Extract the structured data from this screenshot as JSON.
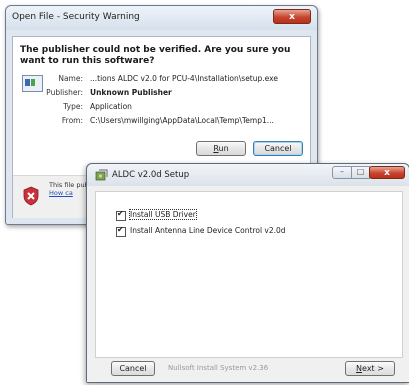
{
  "security_dialog": {
    "title": "Open File - Security Warning",
    "close_label": "x",
    "question": "The publisher could not be verified.  Are you sure you want to run this software?",
    "fields": [
      {
        "label": "Name:",
        "value": "...tions ALDC v2.0 for PCU-4\\Installation\\setup.exe",
        "bold": false
      },
      {
        "label": "Publisher:",
        "value": "Unknown Publisher",
        "bold": true
      },
      {
        "label": "Type:",
        "value": "Application",
        "bold": false
      },
      {
        "label": "From:",
        "value": "C:\\Users\\mwillging\\AppData\\Local\\Temp\\Temp1...",
        "bold": false
      }
    ],
    "run_button": {
      "accel": "R",
      "rest": "un"
    },
    "cancel_button": "Cancel",
    "warning_text": "This file publish",
    "warning_link": "How ca"
  },
  "setup_window": {
    "title": "ALDC v2.0d Setup",
    "minimize_icon": "minimize-icon",
    "maximize_icon": "maximize-icon",
    "close_label": "x",
    "checkboxes": [
      {
        "label": "Install USB Driver",
        "checked": true
      },
      {
        "label": "Install Antenna Line Device Control v2.0d",
        "checked": true
      }
    ],
    "cancel_button": "Cancel",
    "footer": "Nullsoft Install System v2.36",
    "next_button": {
      "accel": "N",
      "rest": "ext >"
    }
  },
  "colors": {
    "close_red": "#c74530",
    "link_blue": "#1e4fb5",
    "shield_red": "#c8323a"
  }
}
